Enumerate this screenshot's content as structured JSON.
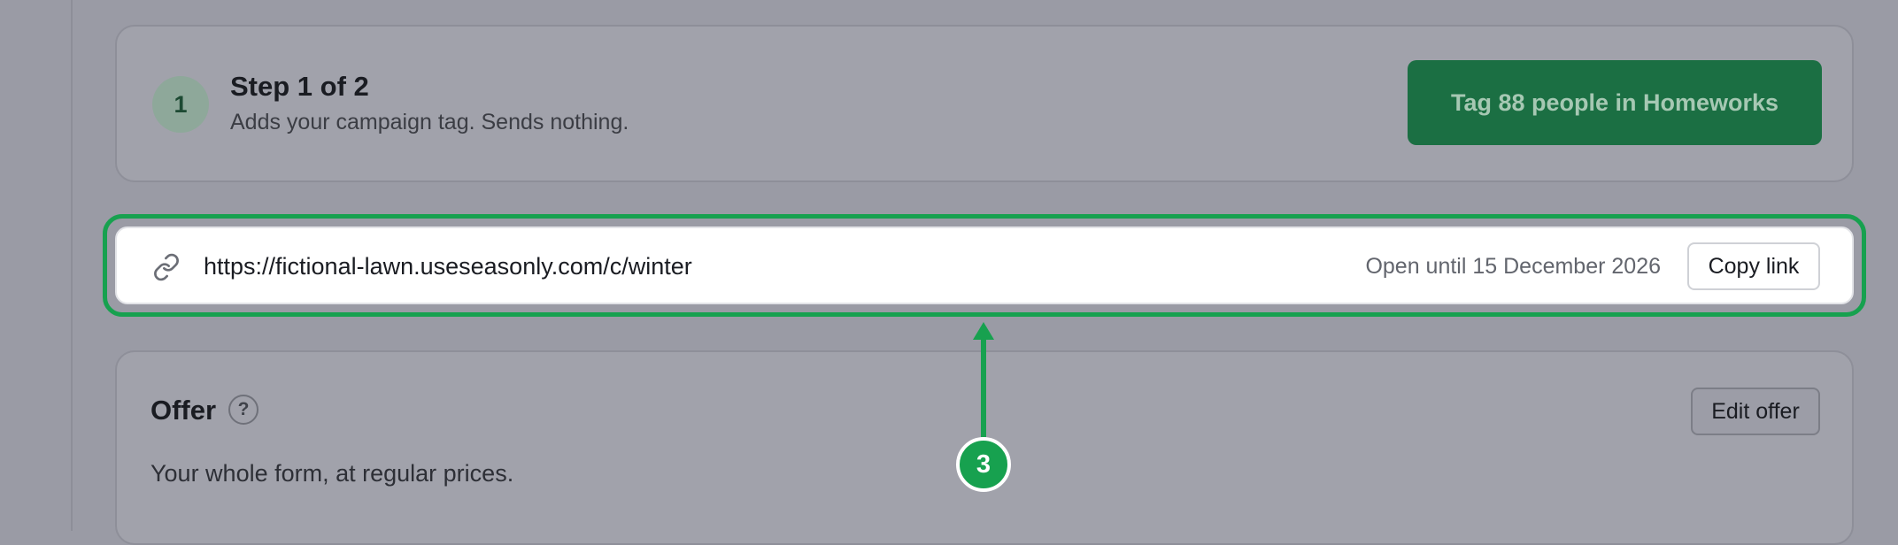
{
  "step": {
    "number": "1",
    "title": "Step 1 of 2",
    "subtitle": "Adds your campaign tag. Sends nothing.",
    "action_label": "Tag 88 people in Homeworks"
  },
  "link": {
    "icon": "link-icon",
    "url": "https://fictional-lawn.useseasonly.com/c/winter",
    "status": "Open until 15 December 2026",
    "copy_label": "Copy link"
  },
  "offer": {
    "title": "Offer",
    "help_label": "?",
    "description": "Your whole form, at regular prices.",
    "edit_label": "Edit offer"
  },
  "callout": {
    "number": "3",
    "color": "#17a14f"
  },
  "colors": {
    "accent": "#1b6f43",
    "highlight": "#17a14f"
  }
}
